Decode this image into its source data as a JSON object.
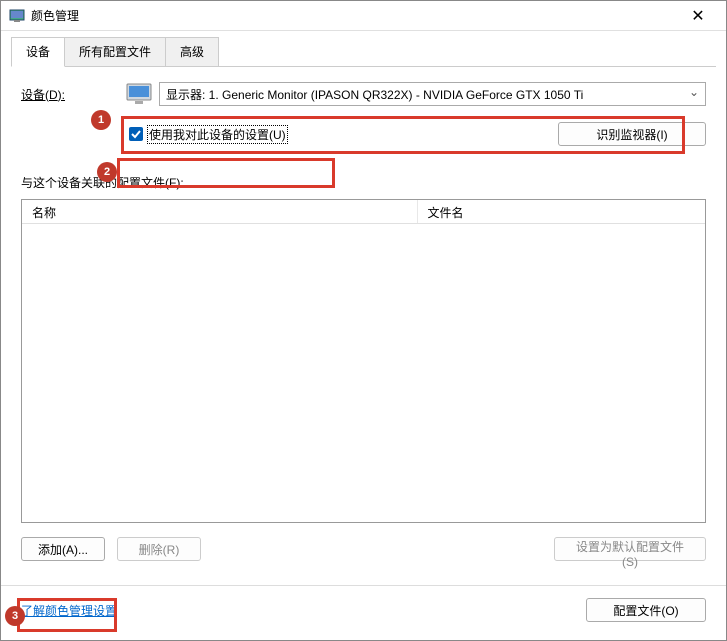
{
  "window": {
    "title": "颜色管理"
  },
  "tabs": {
    "device": "设备",
    "all_profiles": "所有配置文件",
    "advanced": "高级"
  },
  "device": {
    "label_prefix": "设备(",
    "label_key": "D",
    "label_suffix": "):",
    "selected": "显示器: 1. Generic Monitor (IPASON QR322X) - NVIDIA GeForce GTX 1050 Ti",
    "use_my_settings": "使用我对此设备的设置(U)",
    "identify": "识别监视器(I)"
  },
  "assoc": {
    "label": "与这个设备关联的配置文件(F):",
    "col_name": "名称",
    "col_file": "文件名"
  },
  "buttons": {
    "add": "添加(A)...",
    "remove": "删除(R)",
    "set_default": "设置为默认配置文件(S)",
    "profiles": "配置文件(O)"
  },
  "link": {
    "learn_more": "了解颜色管理设置"
  },
  "callouts": {
    "c1": "1",
    "c2": "2",
    "c3": "3"
  }
}
